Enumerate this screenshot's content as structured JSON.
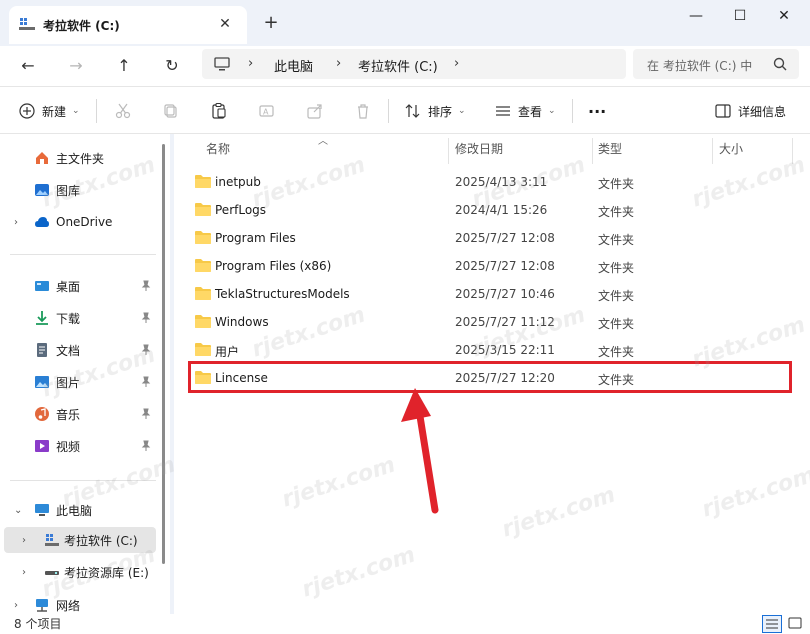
{
  "window": {
    "tab_title": "考拉软件 (C:)",
    "new_tab": "+",
    "minimize": "—",
    "maximize": "☐",
    "close": "✕",
    "tab_close": "✕"
  },
  "address": {
    "crumbs": [
      "此电脑",
      "考拉软件 (C:)"
    ],
    "search_placeholder": "在 考拉软件 (C:) 中"
  },
  "toolbar": {
    "new_label": "新建",
    "sort_label": "排序",
    "view_label": "查看",
    "more_label": "···",
    "details_label": "详细信息"
  },
  "sidebar": {
    "top": [
      {
        "label": "主文件夹",
        "icon": "home-icon"
      },
      {
        "label": "图库",
        "icon": "gallery-icon"
      },
      {
        "label": "OneDrive",
        "icon": "cloud-icon"
      }
    ],
    "quick": [
      {
        "label": "桌面",
        "icon": "desktop-icon"
      },
      {
        "label": "下载",
        "icon": "download-icon"
      },
      {
        "label": "文档",
        "icon": "document-icon"
      },
      {
        "label": "图片",
        "icon": "picture-icon"
      },
      {
        "label": "音乐",
        "icon": "music-icon"
      },
      {
        "label": "视频",
        "icon": "video-icon"
      }
    ],
    "tree": [
      {
        "label": "此电脑",
        "icon": "pc-icon"
      },
      {
        "label": "考拉软件 (C:)",
        "icon": "drive-c-icon"
      },
      {
        "label": "考拉资源库 (E:)",
        "icon": "drive-e-icon"
      },
      {
        "label": "网络",
        "icon": "network-icon"
      }
    ]
  },
  "columns": {
    "name": "名称",
    "modified": "修改日期",
    "type": "类型",
    "size": "大小"
  },
  "files": [
    {
      "name": "inetpub",
      "date": "2025/4/13 3:11",
      "type": "文件夹"
    },
    {
      "name": "PerfLogs",
      "date": "2024/4/1 15:26",
      "type": "文件夹"
    },
    {
      "name": "Program Files",
      "date": "2025/7/27 12:08",
      "type": "文件夹"
    },
    {
      "name": "Program Files (x86)",
      "date": "2025/7/27 12:08",
      "type": "文件夹"
    },
    {
      "name": "TeklaStructuresModels",
      "date": "2025/7/27 10:46",
      "type": "文件夹"
    },
    {
      "name": "Windows",
      "date": "2025/7/27 11:12",
      "type": "文件夹"
    },
    {
      "name": "用户",
      "date": "2025/3/15 22:11",
      "type": "文件夹"
    },
    {
      "name": "Lincense",
      "date": "2025/7/27 12:20",
      "type": "文件夹"
    }
  ],
  "status": {
    "count": "8 个项目"
  },
  "colors": {
    "highlight": "#e0232b",
    "folder": "#f7c948",
    "accent": "#1a6fd6"
  },
  "watermark": "rjetx.com"
}
